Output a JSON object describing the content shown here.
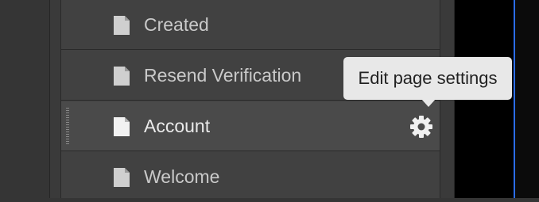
{
  "pages_list": {
    "items": [
      {
        "label": "Created",
        "icon": "page-icon"
      },
      {
        "label": "Resend Verification",
        "icon": "page-icon"
      },
      {
        "label": "Account",
        "icon": "page-icon",
        "active": true,
        "settings_icon": "gear-icon"
      },
      {
        "label": "Welcome",
        "icon": "page-icon"
      }
    ]
  },
  "tooltip": {
    "text": "Edit page settings"
  },
  "colors": {
    "panel": "#414141",
    "active_row": "#4a4a4a",
    "text": "#c9c9c9",
    "active_text": "#eaeaea",
    "tooltip_bg": "#e8e8e8",
    "accent_line": "#2b6df0"
  }
}
